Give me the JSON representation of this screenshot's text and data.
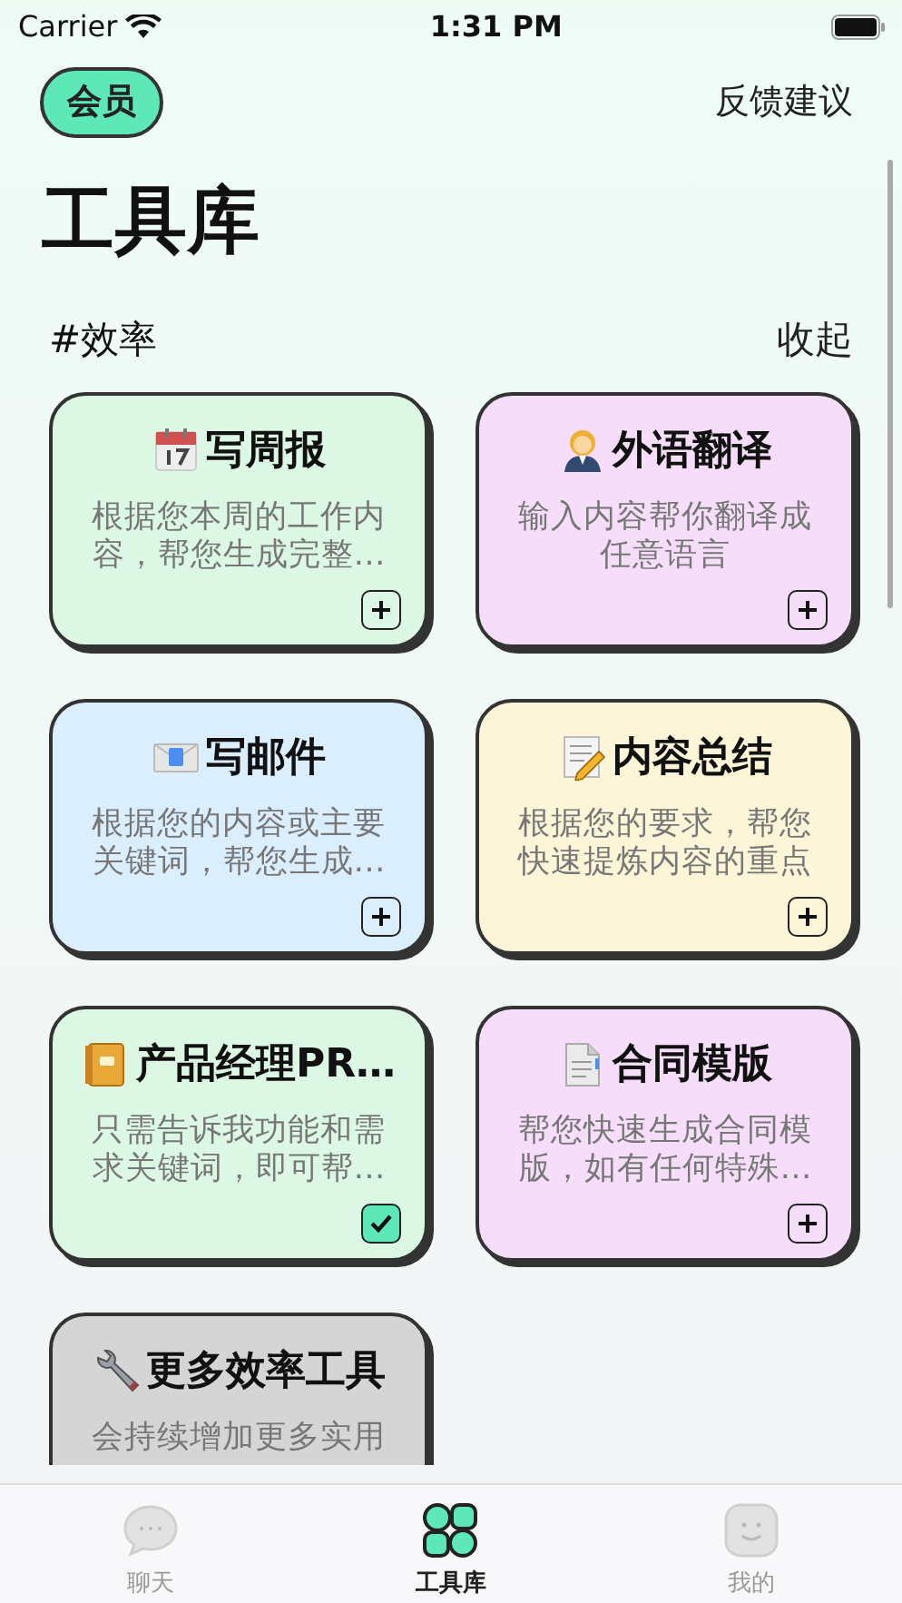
{
  "status_bar": {
    "carrier": "Carrier",
    "time": "1:31 PM"
  },
  "header": {
    "member_button": "会员",
    "feedback_link": "反馈建议"
  },
  "title": "工具库",
  "section": {
    "name": "#效率",
    "toggle": "收起"
  },
  "tools": [
    {
      "title": "写周报",
      "description": "根据您本周的工作内容，帮您生成完整…",
      "color": "#dcf7e3",
      "added": false
    },
    {
      "title": "外语翻译",
      "description": "输入内容帮你翻译成任意语言",
      "color": "#f6defa",
      "added": false
    },
    {
      "title": "写邮件",
      "description": "根据您的内容或主要关键词，帮您生成…",
      "color": "#dbeefe",
      "added": false
    },
    {
      "title": "内容总结",
      "description": "根据您的要求，帮您快速提炼内容的重点",
      "color": "#fdf5d8",
      "added": false
    },
    {
      "title": "产品经理PR…",
      "description": "只需告诉我功能和需求关键词，即可帮…",
      "color": "#dcf7e3",
      "added": true
    },
    {
      "title": "合同模版",
      "description": "帮您快速生成合同模版，如有任何特殊…",
      "color": "#f6defa",
      "added": false
    },
    {
      "title": "更多效率工具",
      "description": "会持续增加更多实用",
      "color": "#d5d5d5"
    }
  ],
  "tab_bar": [
    {
      "label": "聊天",
      "selected": false
    },
    {
      "label": "工具库",
      "selected": true
    },
    {
      "label": "我的",
      "selected": false
    }
  ]
}
